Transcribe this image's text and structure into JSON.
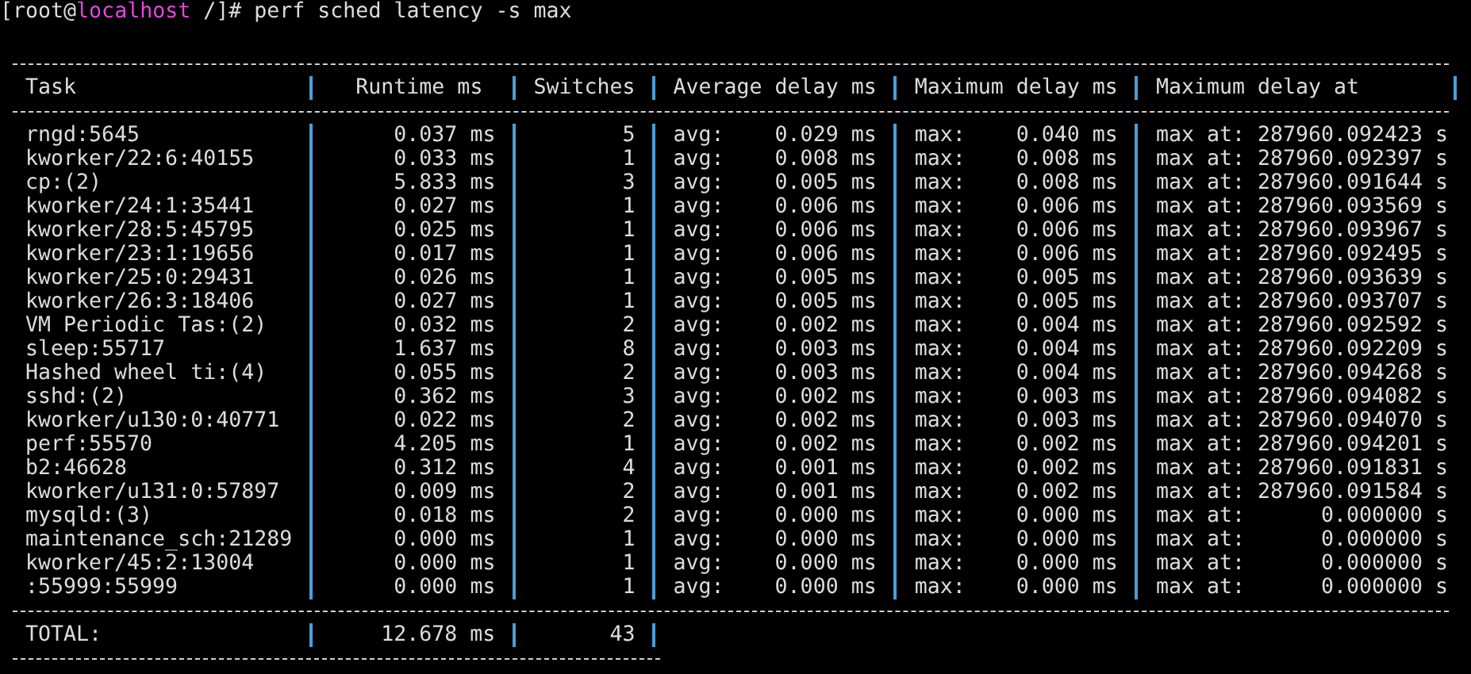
{
  "prompt": {
    "user": "[root@",
    "host": "localhost",
    "path": "/]#",
    "command": "perf sched latency -s max"
  },
  "table": {
    "columns": [
      "Task",
      "Runtime ms",
      "Switches",
      "Average delay ms",
      "Maximum delay ms",
      "Maximum delay at"
    ],
    "rows": [
      {
        "task": "rngd:5645",
        "runtime": "0.037 ms",
        "switches": "5",
        "avg_label": "avg:",
        "avg": "0.029 ms",
        "max_label": "max:",
        "max": "0.040 ms",
        "max_at_label": "max at:",
        "max_at": "287960.092423 s"
      },
      {
        "task": "kworker/22:6:40155",
        "runtime": "0.033 ms",
        "switches": "1",
        "avg_label": "avg:",
        "avg": "0.008 ms",
        "max_label": "max:",
        "max": "0.008 ms",
        "max_at_label": "max at:",
        "max_at": "287960.092397 s"
      },
      {
        "task": "cp:(2)",
        "runtime": "5.833 ms",
        "switches": "3",
        "avg_label": "avg:",
        "avg": "0.005 ms",
        "max_label": "max:",
        "max": "0.008 ms",
        "max_at_label": "max at:",
        "max_at": "287960.091644 s"
      },
      {
        "task": "kworker/24:1:35441",
        "runtime": "0.027 ms",
        "switches": "1",
        "avg_label": "avg:",
        "avg": "0.006 ms",
        "max_label": "max:",
        "max": "0.006 ms",
        "max_at_label": "max at:",
        "max_at": "287960.093569 s"
      },
      {
        "task": "kworker/28:5:45795",
        "runtime": "0.025 ms",
        "switches": "1",
        "avg_label": "avg:",
        "avg": "0.006 ms",
        "max_label": "max:",
        "max": "0.006 ms",
        "max_at_label": "max at:",
        "max_at": "287960.093967 s"
      },
      {
        "task": "kworker/23:1:19656",
        "runtime": "0.017 ms",
        "switches": "1",
        "avg_label": "avg:",
        "avg": "0.006 ms",
        "max_label": "max:",
        "max": "0.006 ms",
        "max_at_label": "max at:",
        "max_at": "287960.092495 s"
      },
      {
        "task": "kworker/25:0:29431",
        "runtime": "0.026 ms",
        "switches": "1",
        "avg_label": "avg:",
        "avg": "0.005 ms",
        "max_label": "max:",
        "max": "0.005 ms",
        "max_at_label": "max at:",
        "max_at": "287960.093639 s"
      },
      {
        "task": "kworker/26:3:18406",
        "runtime": "0.027 ms",
        "switches": "1",
        "avg_label": "avg:",
        "avg": "0.005 ms",
        "max_label": "max:",
        "max": "0.005 ms",
        "max_at_label": "max at:",
        "max_at": "287960.093707 s"
      },
      {
        "task": "VM Periodic Tas:(2)",
        "runtime": "0.032 ms",
        "switches": "2",
        "avg_label": "avg:",
        "avg": "0.002 ms",
        "max_label": "max:",
        "max": "0.004 ms",
        "max_at_label": "max at:",
        "max_at": "287960.092592 s"
      },
      {
        "task": "sleep:55717",
        "runtime": "1.637 ms",
        "switches": "8",
        "avg_label": "avg:",
        "avg": "0.003 ms",
        "max_label": "max:",
        "max": "0.004 ms",
        "max_at_label": "max at:",
        "max_at": "287960.092209 s"
      },
      {
        "task": "Hashed wheel ti:(4)",
        "runtime": "0.055 ms",
        "switches": "2",
        "avg_label": "avg:",
        "avg": "0.003 ms",
        "max_label": "max:",
        "max": "0.004 ms",
        "max_at_label": "max at:",
        "max_at": "287960.094268 s"
      },
      {
        "task": "sshd:(2)",
        "runtime": "0.362 ms",
        "switches": "3",
        "avg_label": "avg:",
        "avg": "0.002 ms",
        "max_label": "max:",
        "max": "0.003 ms",
        "max_at_label": "max at:",
        "max_at": "287960.094082 s"
      },
      {
        "task": "kworker/u130:0:40771",
        "runtime": "0.022 ms",
        "switches": "2",
        "avg_label": "avg:",
        "avg": "0.002 ms",
        "max_label": "max:",
        "max": "0.003 ms",
        "max_at_label": "max at:",
        "max_at": "287960.094070 s"
      },
      {
        "task": "perf:55570",
        "runtime": "4.205 ms",
        "switches": "1",
        "avg_label": "avg:",
        "avg": "0.002 ms",
        "max_label": "max:",
        "max": "0.002 ms",
        "max_at_label": "max at:",
        "max_at": "287960.094201 s"
      },
      {
        "task": "b2:46628",
        "runtime": "0.312 ms",
        "switches": "4",
        "avg_label": "avg:",
        "avg": "0.001 ms",
        "max_label": "max:",
        "max": "0.002 ms",
        "max_at_label": "max at:",
        "max_at": "287960.091831 s"
      },
      {
        "task": "kworker/u131:0:57897",
        "runtime": "0.009 ms",
        "switches": "2",
        "avg_label": "avg:",
        "avg": "0.001 ms",
        "max_label": "max:",
        "max": "0.002 ms",
        "max_at_label": "max at:",
        "max_at": "287960.091584 s"
      },
      {
        "task": "mysqld:(3)",
        "runtime": "0.018 ms",
        "switches": "2",
        "avg_label": "avg:",
        "avg": "0.000 ms",
        "max_label": "max:",
        "max": "0.000 ms",
        "max_at_label": "max at:",
        "max_at": "0.000000 s"
      },
      {
        "task": "maintenance_sch:21289",
        "runtime": "0.000 ms",
        "switches": "1",
        "avg_label": "avg:",
        "avg": "0.000 ms",
        "max_label": "max:",
        "max": "0.000 ms",
        "max_at_label": "max at:",
        "max_at": "0.000000 s"
      },
      {
        "task": "kworker/45:2:13004",
        "runtime": "0.000 ms",
        "switches": "1",
        "avg_label": "avg:",
        "avg": "0.000 ms",
        "max_label": "max:",
        "max": "0.000 ms",
        "max_at_label": "max at:",
        "max_at": "0.000000 s"
      },
      {
        "task": ":55999:55999",
        "runtime": "0.000 ms",
        "switches": "1",
        "avg_label": "avg:",
        "avg": "0.000 ms",
        "max_label": "max:",
        "max": "0.000 ms",
        "max_at_label": "max at:",
        "max_at": "0.000000 s"
      }
    ],
    "total": {
      "label": "TOTAL:",
      "runtime": "12.678 ms",
      "switches": "43"
    }
  }
}
